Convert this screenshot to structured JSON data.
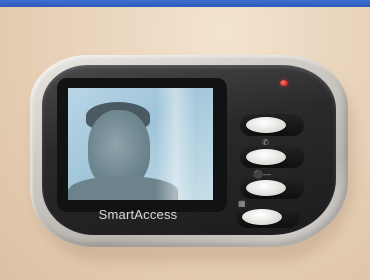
{
  "device": {
    "brand_label": "SmartAccess"
  },
  "buttons": [
    {
      "name": "top-button"
    },
    {
      "name": "middle-button",
      "icon": "phone-icon"
    },
    {
      "name": "lower-button",
      "icon": "key-icon"
    },
    {
      "name": "bottom-button",
      "icon": "gate-icon"
    }
  ],
  "colors": {
    "wall": "#e9d3bb",
    "device_silver": "#cfcbc6",
    "device_black": "#1c1c1e",
    "screen_tint": "#b9d6e6",
    "led_red": "#c7261c",
    "top_bar": "#3d6fd1"
  }
}
